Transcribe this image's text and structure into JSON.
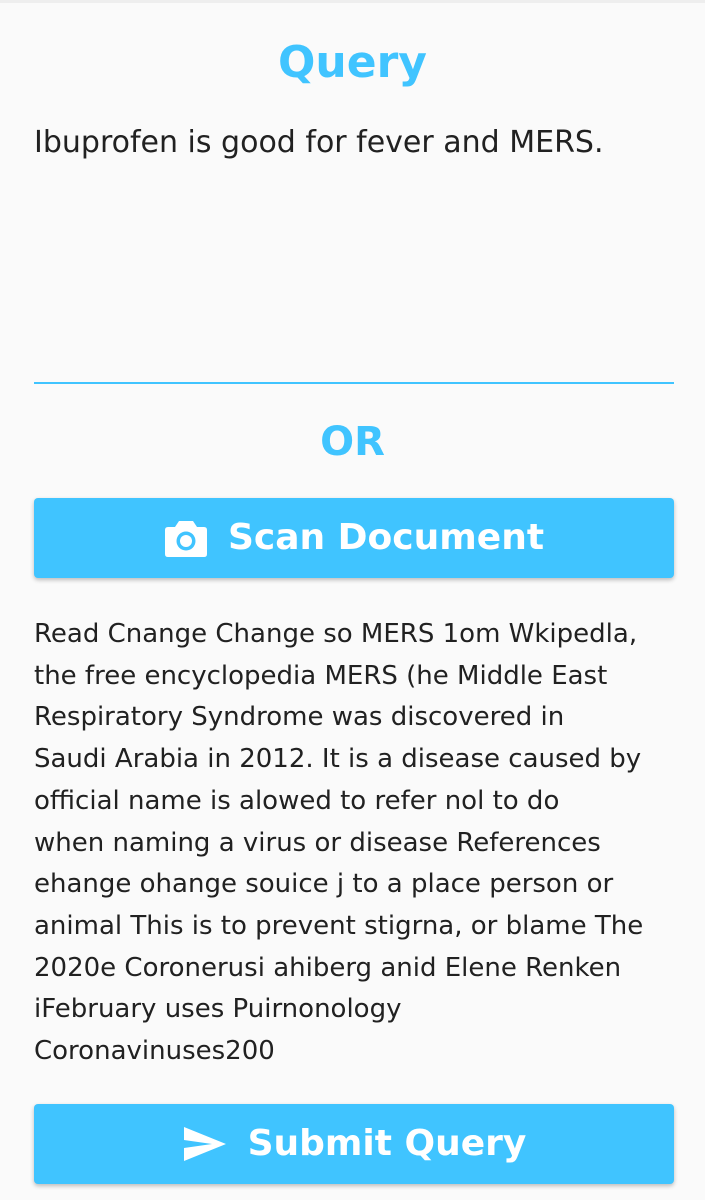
{
  "header": {
    "title": "Query"
  },
  "query": {
    "value": "Ibuprofen is good for fever and MERS."
  },
  "divider": {
    "or_label": "OR"
  },
  "scan_button": {
    "label": "Scan Document",
    "icon": "camera-icon"
  },
  "scanned_text": {
    "lines": [
      "Read Cnange Change so MERS 1om Wkipedla,",
      "the free encyclopedia MERS (he Middle East",
      "Respiratory Syndrome was discovered in",
      "Saudi Arabia in 2012. It is a disease caused by",
      "official name is alowed to refer nol to do",
      "when naming a virus or disease References",
      "ehange ohange souice j to a place person or",
      "animal This is to prevent stigrna, or blame The",
      "2020e Coronerusi ahiberg anid Elene Renken",
      "iFebruary uses Puirnonology",
      "Coronavinuses200"
    ]
  },
  "submit_button": {
    "label": "Submit Query",
    "icon": "send-icon"
  },
  "colors": {
    "accent": "#40c4ff",
    "background": "#fafafa",
    "text": "#212121",
    "button_text": "#ffffff"
  }
}
